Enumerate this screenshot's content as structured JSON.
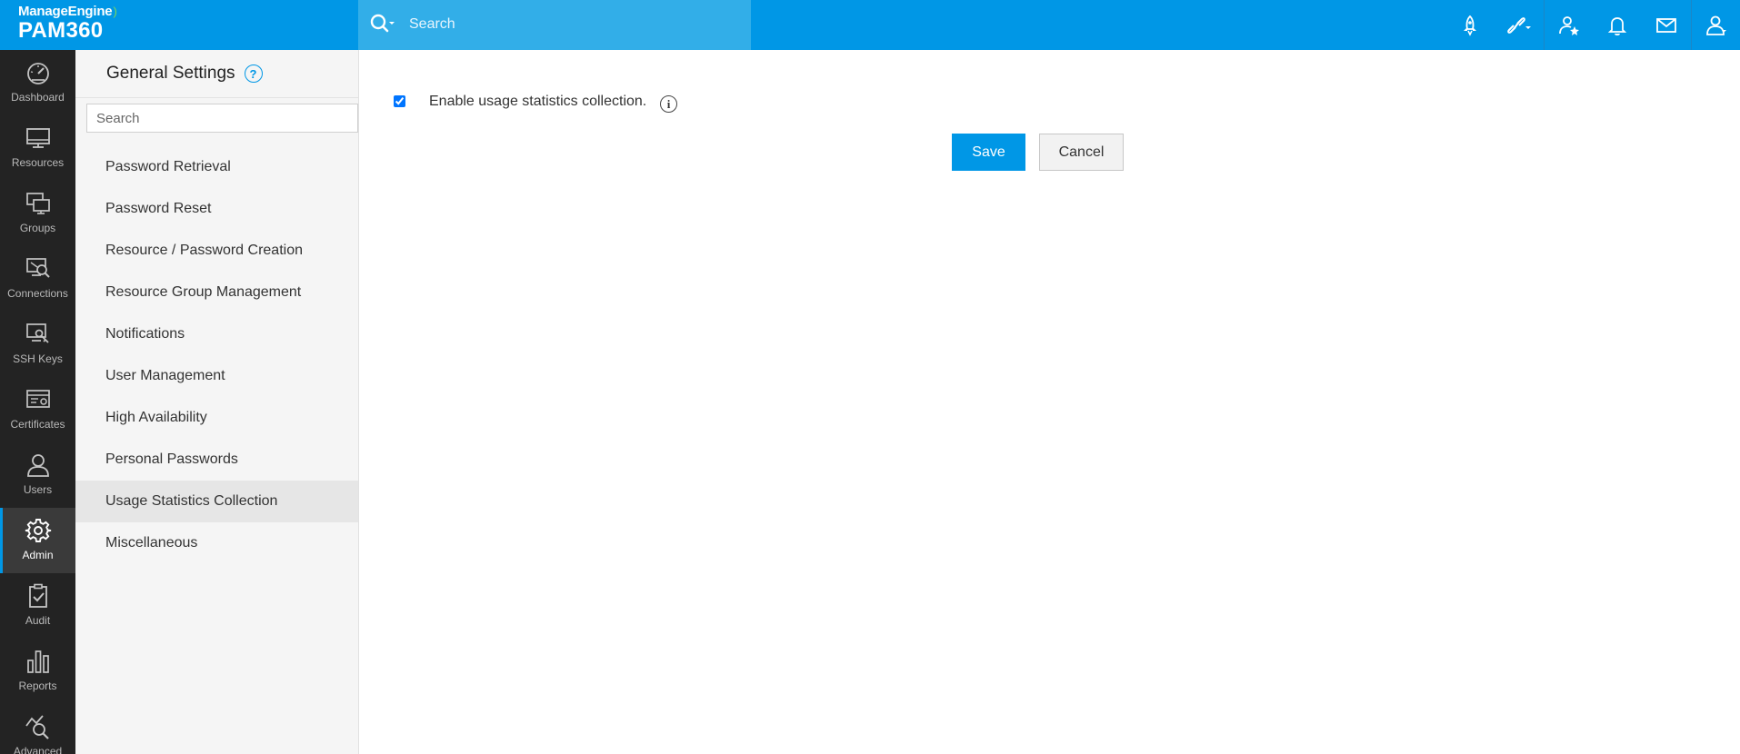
{
  "brand": {
    "vendor": "ManageEngine",
    "product": "PAM360"
  },
  "search": {
    "placeholder": "Search"
  },
  "header_icons": [
    "rocket-icon",
    "link-settings-icon",
    "user-star-icon",
    "bell-icon",
    "mail-icon",
    "user-profile-icon"
  ],
  "nav": {
    "items": [
      {
        "label": "Dashboard",
        "icon": "gauge-icon"
      },
      {
        "label": "Resources",
        "icon": "monitor-icon"
      },
      {
        "label": "Groups",
        "icon": "group-monitors-icon"
      },
      {
        "label": "Connections",
        "icon": "connection-icon"
      },
      {
        "label": "SSH Keys",
        "icon": "ssh-key-icon"
      },
      {
        "label": "Certificates",
        "icon": "certificate-icon"
      },
      {
        "label": "Users",
        "icon": "user-icon"
      },
      {
        "label": "Admin",
        "icon": "gear-icon",
        "active": true
      },
      {
        "label": "Audit",
        "icon": "clipboard-check-icon"
      },
      {
        "label": "Reports",
        "icon": "bar-chart-icon"
      },
      {
        "label": "Advanced",
        "icon": "analytics-icon"
      }
    ]
  },
  "settings": {
    "title": "General Settings",
    "search_placeholder": "Search",
    "items": [
      {
        "label": "Password Retrieval"
      },
      {
        "label": "Password Reset"
      },
      {
        "label": "Resource / Password Creation"
      },
      {
        "label": "Resource Group Management"
      },
      {
        "label": "Notifications"
      },
      {
        "label": "User Management"
      },
      {
        "label": "High Availability"
      },
      {
        "label": "Personal Passwords"
      },
      {
        "label": "Usage Statistics Collection",
        "active": true
      },
      {
        "label": "Miscellaneous"
      }
    ]
  },
  "content": {
    "checkbox_label": "Enable usage statistics collection.",
    "checkbox_checked": true,
    "save_label": "Save",
    "cancel_label": "Cancel"
  },
  "colors": {
    "accent": "#0097e6",
    "sidebar": "#232323",
    "active_nav": "#3a3a3a"
  }
}
